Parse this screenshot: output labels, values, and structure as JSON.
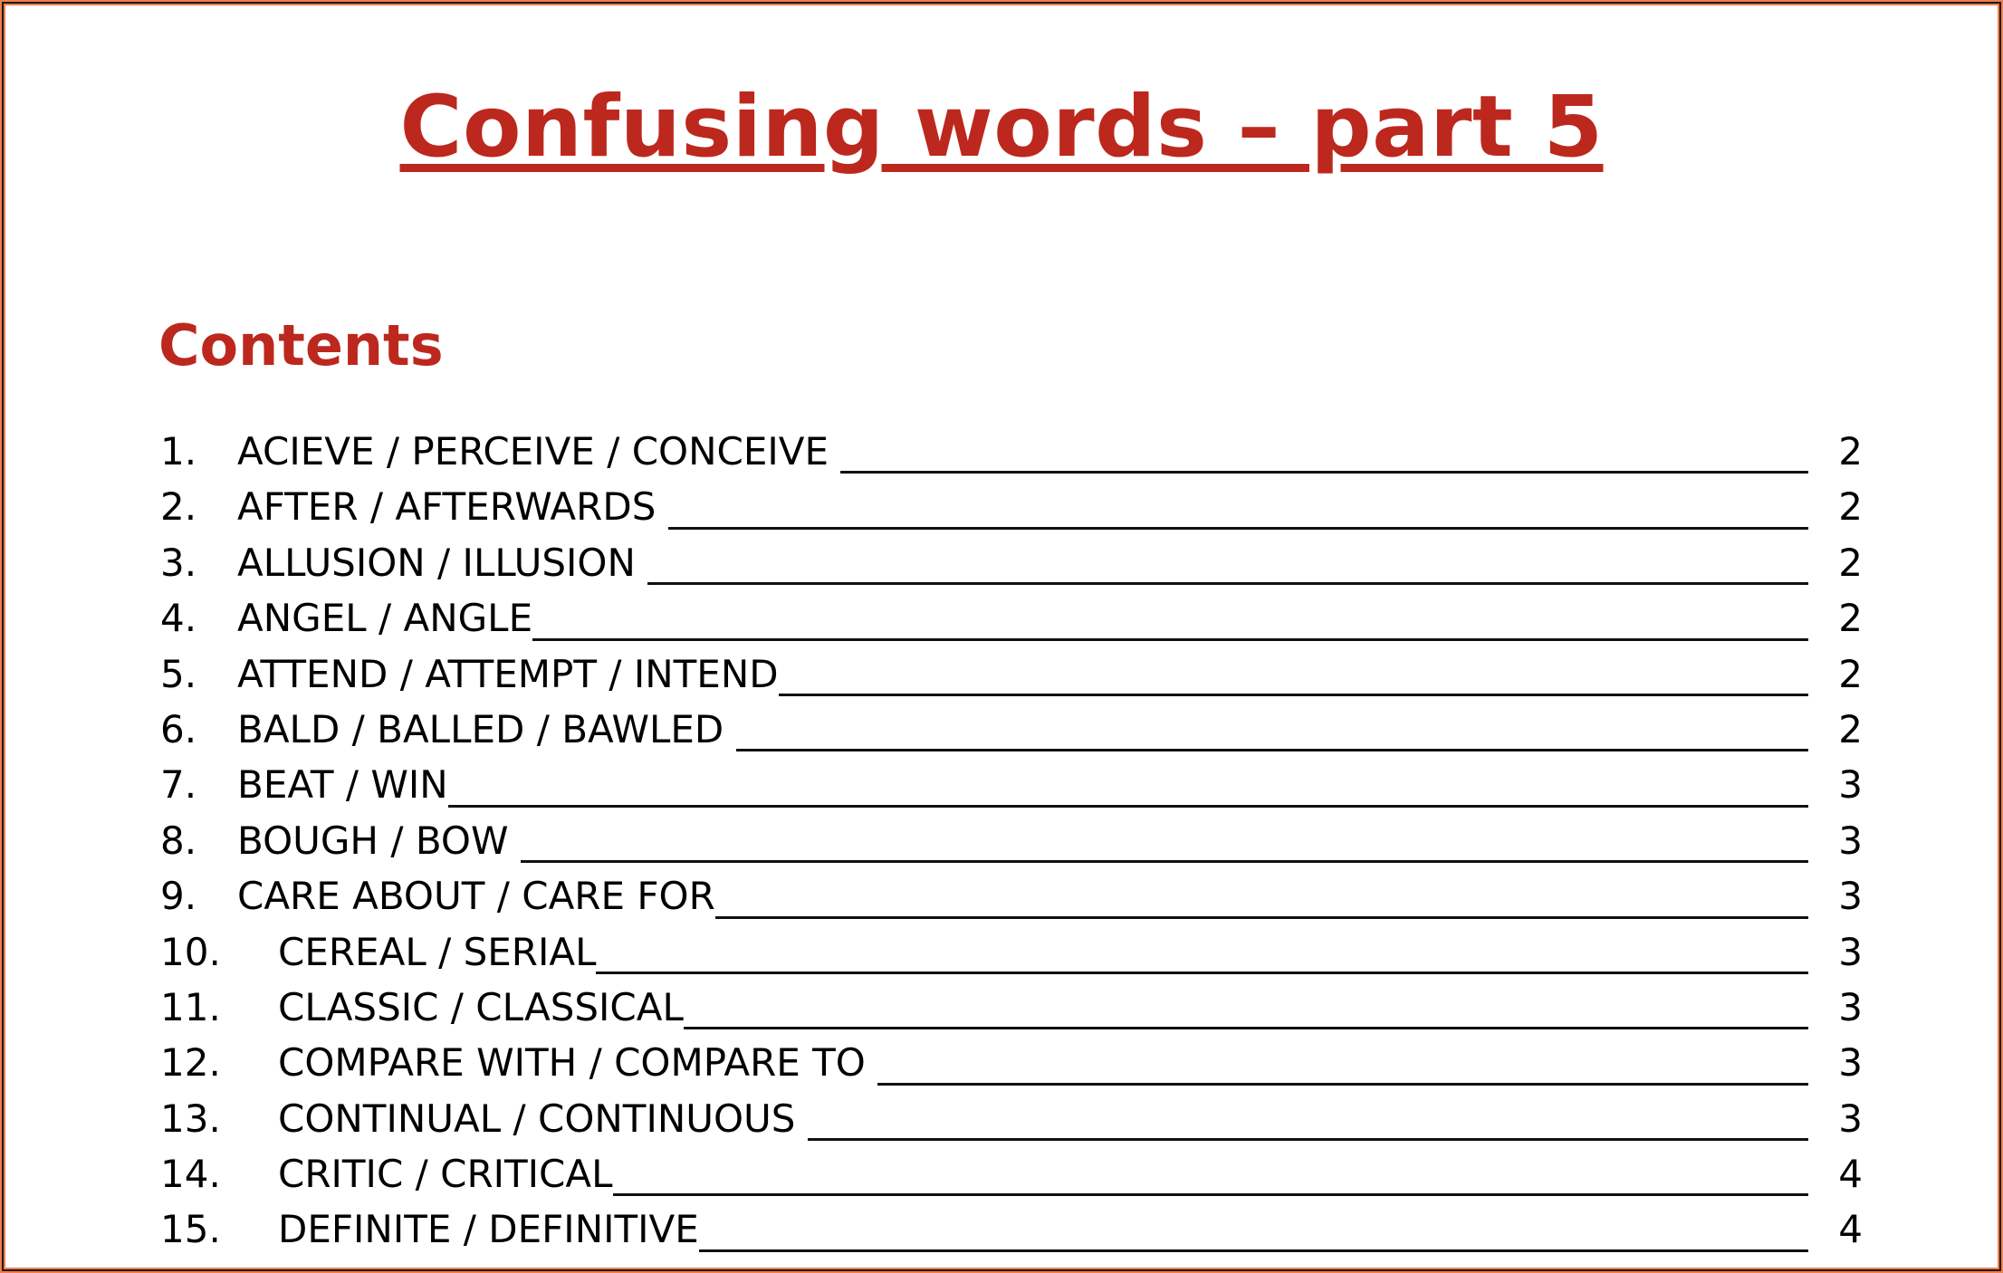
{
  "document": {
    "title": "Confusing words – part 5",
    "contents_heading": "Contents",
    "colors": {
      "accent": "#BC281E",
      "border_orange": "#EE7F4A",
      "border_dark": "#1a1a1a",
      "text": "#000000"
    }
  },
  "toc": [
    {
      "number": "1.",
      "title": "ACIEVE / PERCEIVE / CONCEIVE ",
      "page": "2"
    },
    {
      "number": "2.",
      "title": "AFTER / AFTERWARDS ",
      "page": "2"
    },
    {
      "number": "3.",
      "title": "ALLUSION / ILLUSION ",
      "page": "2"
    },
    {
      "number": "4.",
      "title": "ANGEL / ANGLE",
      "page": "2"
    },
    {
      "number": "5.",
      "title": "ATTEND / ATTEMPT / INTEND",
      "page": "2"
    },
    {
      "number": "6.",
      "title": "BALD / BALLED / BAWLED ",
      "page": "2"
    },
    {
      "number": "7.",
      "title": "BEAT / WIN",
      "page": "3"
    },
    {
      "number": "8.",
      "title": "BOUGH / BOW ",
      "page": "3"
    },
    {
      "number": "9.",
      "title": "CARE ABOUT / CARE FOR",
      "page": "3"
    },
    {
      "number": "10.",
      "title": "CEREAL / SERIAL",
      "page": "3"
    },
    {
      "number": "11.",
      "title": "CLASSIC / CLASSICAL",
      "page": "3"
    },
    {
      "number": "12.",
      "title": "COMPARE WITH / COMPARE TO ",
      "page": "3"
    },
    {
      "number": "13.",
      "title": "CONTINUAL / CONTINUOUS ",
      "page": "3"
    },
    {
      "number": "14.",
      "title": "CRITIC / CRITICAL",
      "page": "4"
    },
    {
      "number": "15.",
      "title": "DEFINITE / DEFINITIVE",
      "page": "4"
    }
  ]
}
